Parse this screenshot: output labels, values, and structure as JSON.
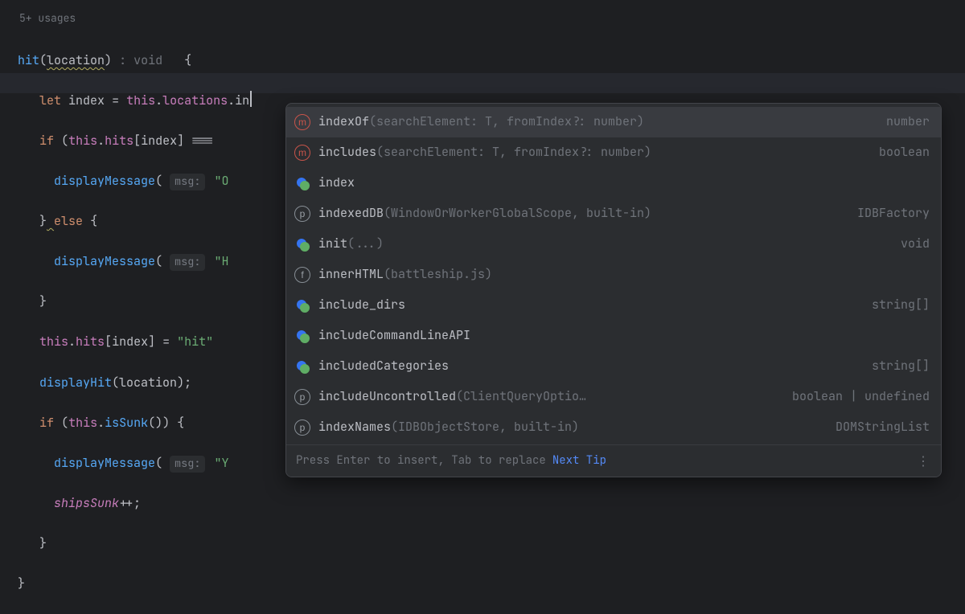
{
  "usages": "5+ usages",
  "code": {
    "fn_name": "hit",
    "fn_param": "location",
    "ret_hint": " : void",
    "let_kw": "let",
    "index_id": "index",
    "this_kw": "this",
    "locations_prop": "locations",
    "typed": "in",
    "if_kw": "if",
    "hits_prop": "hits",
    "eq": "===",
    "else_kw": "else",
    "msg_label": "msg:",
    "str_oops": "\"O",
    "str_hit": "\"H",
    "str_hit2": "\"hit\"",
    "str_you": "\"Y",
    "displayMessage": "displayMessage",
    "displayHit": "displayHit",
    "isSunk": "isSunk",
    "shipsSunk": "shipsSunk",
    "inc": "++"
  },
  "completion": {
    "items": [
      {
        "icon": "m",
        "name": "indexOf",
        "sig": "(searchElement: T, fromIndex?: number)",
        "type": "number"
      },
      {
        "icon": "m",
        "name": "includes",
        "sig": "(searchElement: T, fromIndex?: number)",
        "type": "boolean"
      },
      {
        "icon": "dot",
        "name": "index",
        "sig": "",
        "type": ""
      },
      {
        "icon": "p",
        "name": "indexedDB",
        "sig": " (WindowOrWorkerGlobalScope, built-in)",
        "type": "IDBFactory"
      },
      {
        "icon": "dot",
        "name": "init",
        "sig": "(...)",
        "type": "void"
      },
      {
        "icon": "f",
        "name": "innerHTML",
        "sig": " (battleship.js)",
        "type": ""
      },
      {
        "icon": "dot",
        "name": "include_dirs",
        "sig": "",
        "type": "string[]"
      },
      {
        "icon": "dot",
        "name": "includeCommandLineAPI",
        "sig": "",
        "type": ""
      },
      {
        "icon": "dot",
        "name": "includedCategories",
        "sig": "",
        "type": "string[]"
      },
      {
        "icon": "p",
        "name": "includeUncontrolled",
        "sig": " (ClientQueryOptio…",
        "type": "boolean | undefined"
      },
      {
        "icon": "p",
        "name": "indexNames",
        "sig": " (IDBObjectStore, built-in)",
        "type": "DOMStringList"
      }
    ],
    "footer_hint": "Press Enter to insert, Tab to replace",
    "footer_link": "Next Tip"
  }
}
